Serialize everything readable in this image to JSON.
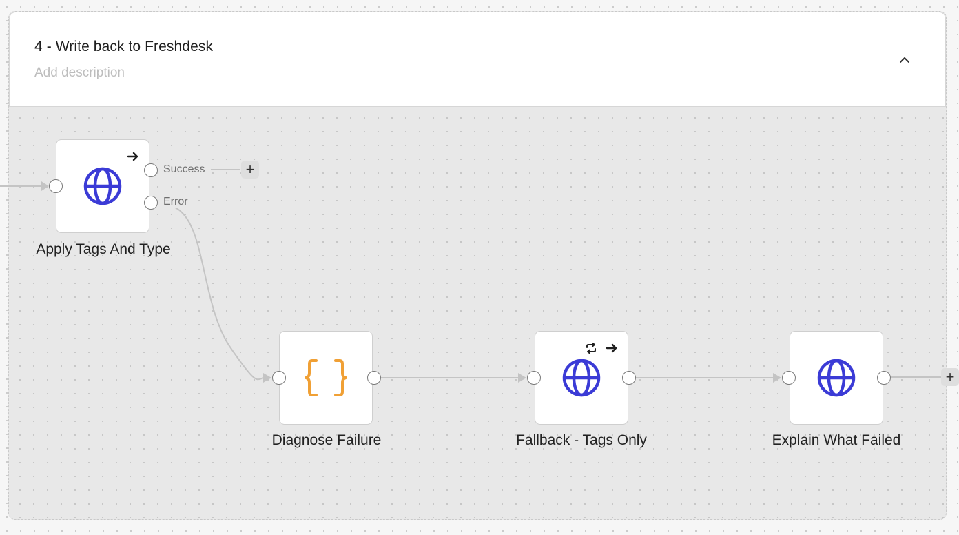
{
  "group": {
    "title": "4 - Write back to Freshdesk",
    "description_placeholder": "Add description",
    "collapse_icon": "chevron-up-icon"
  },
  "nodes": {
    "apply_tags": {
      "label": "Apply Tags And Type",
      "icon": "globe-icon",
      "badges": [
        "arrow-right-icon"
      ],
      "outputs": [
        "Success",
        "Error"
      ]
    },
    "diagnose": {
      "label": "Diagnose Failure",
      "icon": "curly-braces-icon",
      "badges": []
    },
    "fallback": {
      "label": "Fallback - Tags Only",
      "icon": "globe-icon",
      "badges": [
        "retry-icon",
        "arrow-right-icon"
      ]
    },
    "explain": {
      "label": "Explain What Failed",
      "icon": "globe-icon",
      "badges": []
    }
  },
  "colors": {
    "http_icon": "#3b3bd6",
    "code_icon": "#f0a035",
    "edge": "#c4c4c4"
  }
}
